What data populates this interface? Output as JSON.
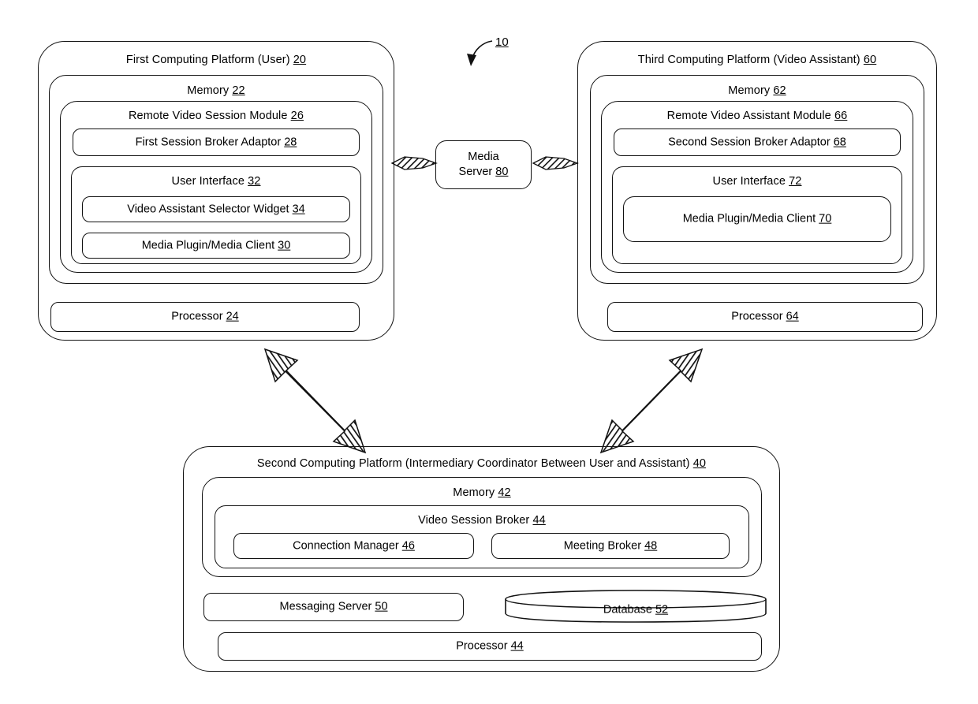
{
  "figure": {
    "reference_numeral": "10",
    "background_color": "#ffffff",
    "line_color": "#111111"
  },
  "platforms": {
    "first": {
      "title": "First Computing Platform (User)",
      "number": "20",
      "memory": {
        "title": "Memory",
        "number": "22"
      },
      "module": {
        "title": "Remote Video Session Module",
        "number": "26"
      },
      "adaptor": {
        "title": "First Session Broker Adaptor",
        "number": "28"
      },
      "user_interface": {
        "title": "User Interface",
        "number": "32"
      },
      "widget": {
        "title": "Video Assistant Selector Widget",
        "number": "34"
      },
      "media_plugin": {
        "title": "Media Plugin/Media Client",
        "number": "30"
      },
      "processor": {
        "title": "Processor",
        "number": "24"
      }
    },
    "third": {
      "title": "Third Computing Platform (Video Assistant)",
      "number": "60",
      "memory": {
        "title": "Memory",
        "number": "62"
      },
      "module": {
        "title": "Remote Video Assistant Module",
        "number": "66"
      },
      "adaptor": {
        "title": "Second Session Broker Adaptor",
        "number": "68"
      },
      "user_interface": {
        "title": "User Interface",
        "number": "72"
      },
      "media_plugin": {
        "title": "Media Plugin/Media Client",
        "number": "70"
      },
      "processor": {
        "title": "Processor",
        "number": "64"
      }
    },
    "second": {
      "title": "Second Computing Platform (Intermediary Coordinator Between User and Assistant)",
      "number": "40",
      "memory": {
        "title": "Memory",
        "number": "42"
      },
      "video_session_broker": {
        "title": "Video Session Broker",
        "number": "44"
      },
      "connection_manager": {
        "title": "Connection Manager",
        "number": "46"
      },
      "meeting_broker": {
        "title": "Meeting Broker",
        "number": "48"
      },
      "messaging_server": {
        "title": "Messaging Server",
        "number": "50"
      },
      "database": {
        "title": "Database",
        "number": "52"
      },
      "processor": {
        "title": "Processor",
        "number": "44"
      }
    }
  },
  "media_server": {
    "line1": "Media",
    "line2": "Server",
    "number": "80"
  },
  "connectors": [
    {
      "name": "first-platform-to-media-server",
      "style": "double-headed-hatched-horizontal"
    },
    {
      "name": "media-server-to-third-platform",
      "style": "double-headed-hatched-horizontal"
    },
    {
      "name": "first-platform-to-second-platform",
      "style": "double-headed-hatched-diagonal"
    },
    {
      "name": "third-platform-to-second-platform",
      "style": "double-headed-hatched-diagonal"
    }
  ]
}
